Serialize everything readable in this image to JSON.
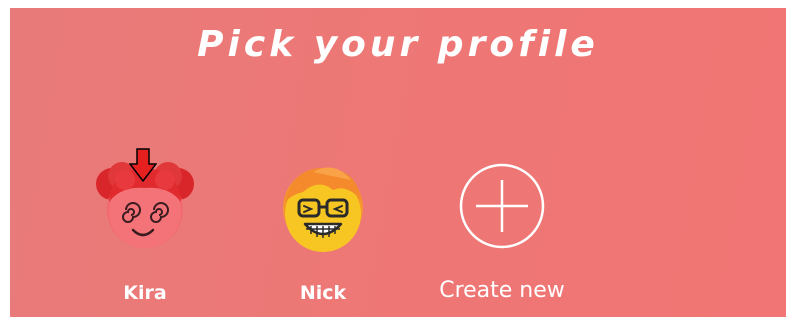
{
  "header": {
    "title": "Pick your profile"
  },
  "profiles": [
    {
      "name": "Kira",
      "avatar": "red-hair-dizzy-face-avatar"
    },
    {
      "name": "Nick",
      "avatar": "orange-hair-glasses-grin-avatar"
    }
  ],
  "create": {
    "label": "Create new",
    "icon": "plus-circle-icon"
  },
  "colors": {
    "background": "#ee7775",
    "text": "#ffffff",
    "kira_hair": "#e02a2e",
    "kira_face": "#f26b70",
    "nick_hair": "#f58a2c",
    "nick_face": "#f7c623",
    "pointer_arrow": "#e5201f"
  }
}
